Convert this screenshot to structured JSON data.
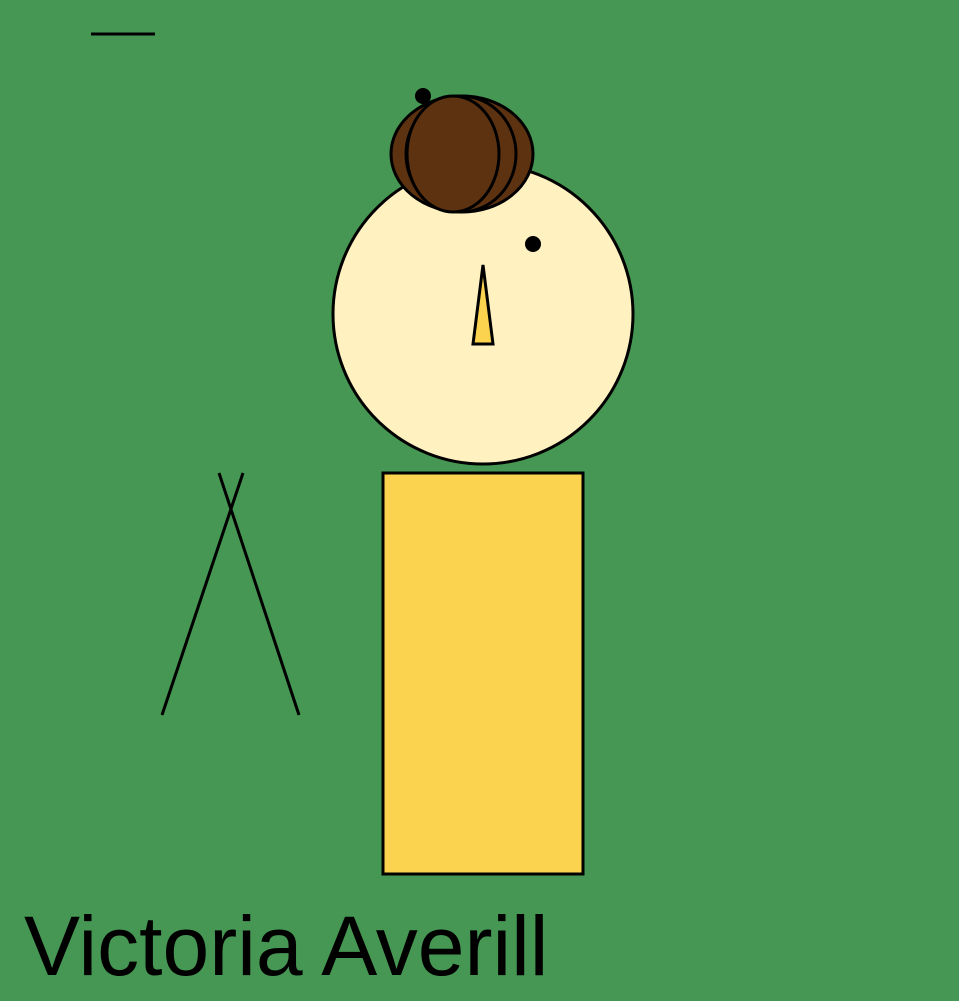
{
  "caption": "Victoria Averill",
  "colors": {
    "background": "#459753",
    "face": "#fff1c0",
    "hair": "#5d3210",
    "body": "#fcd34f",
    "nose": "#fcd34f",
    "outline": "#000000",
    "text": "#000000"
  },
  "icons": {
    "figure": "stick-figure-drawing",
    "eye": "dot",
    "nose": "triangle",
    "hair_bun": "overlapping-ellipses",
    "side_legs": "crossed-lines",
    "top_mark": "horizontal-dash"
  }
}
